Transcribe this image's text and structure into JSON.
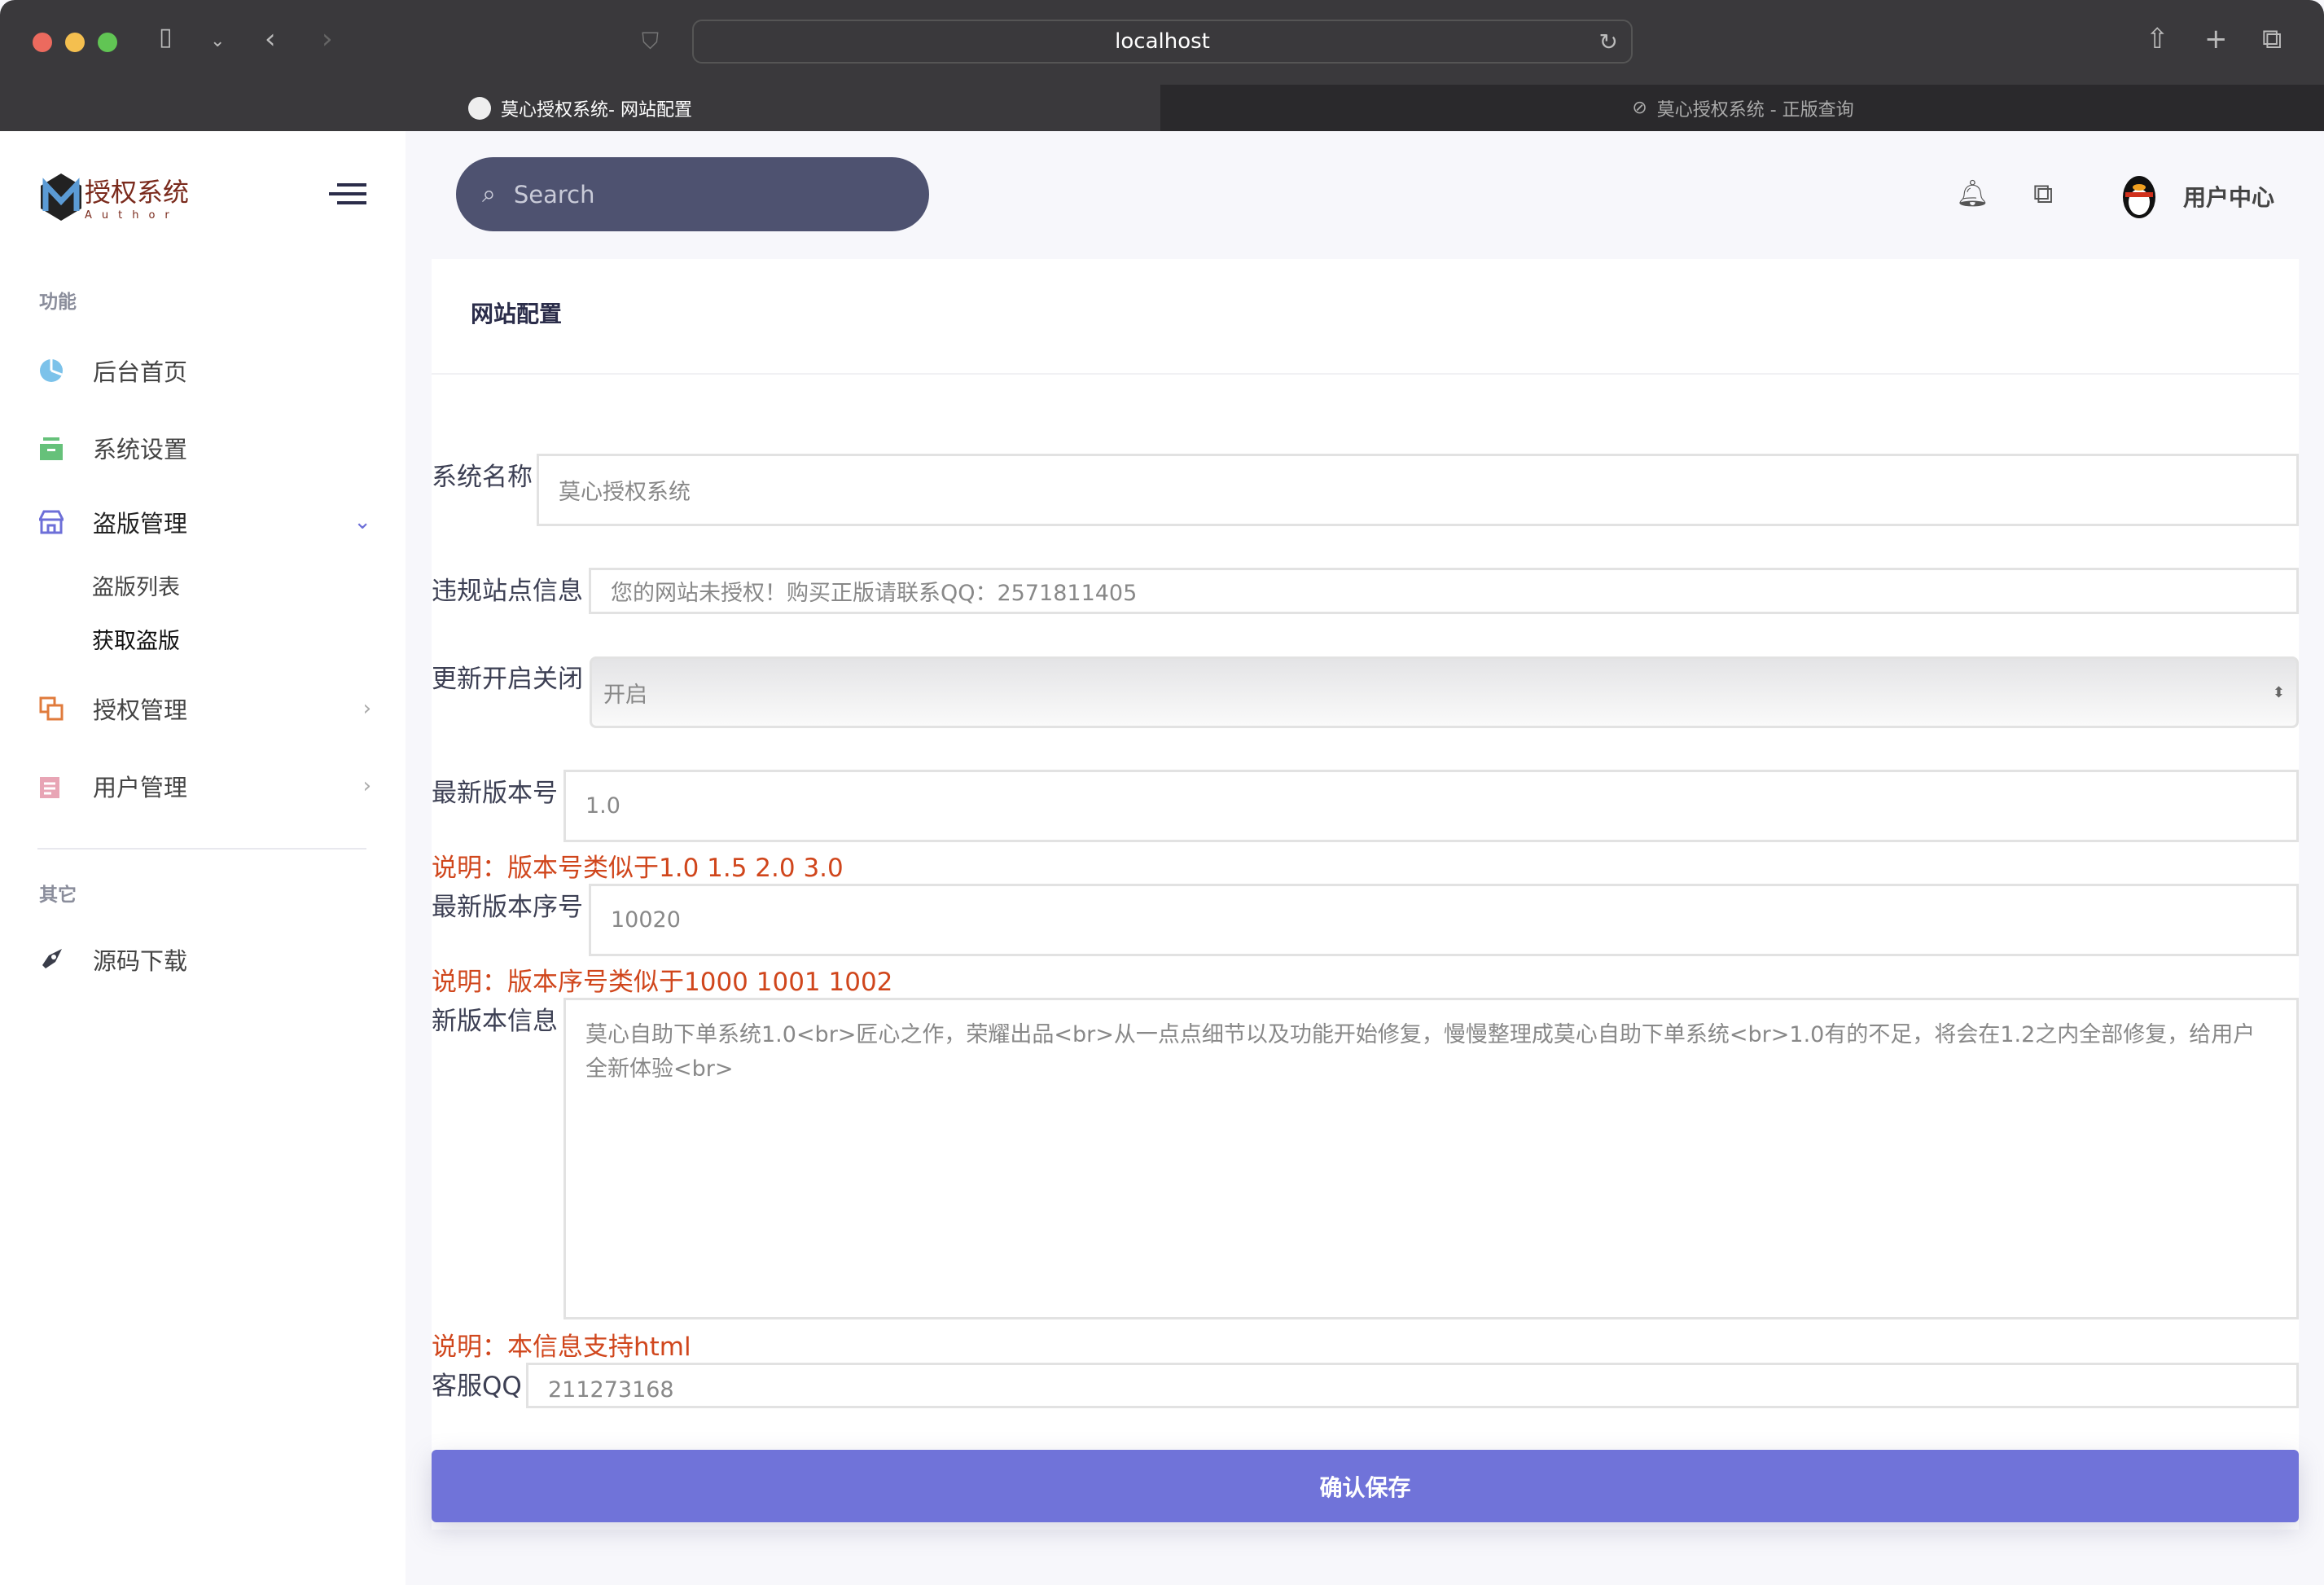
{
  "browser": {
    "url": "localhost",
    "tabs": [
      {
        "label": "莫心授权系统- 网站配置",
        "active": true
      },
      {
        "label": "莫心授权系统 - 正版查询",
        "active": false
      }
    ]
  },
  "sidebar": {
    "logo_text": "授权系统",
    "logo_sub": "Author",
    "section1": "功能",
    "section2": "其它",
    "items": [
      {
        "label": "后台首页",
        "icon": "pie-chart-icon"
      },
      {
        "label": "系统设置",
        "icon": "archive-icon"
      },
      {
        "label": "盗版管理",
        "icon": "store-icon",
        "expanded": true
      },
      {
        "label": "授权管理",
        "icon": "copy-icon"
      },
      {
        "label": "用户管理",
        "icon": "document-icon"
      }
    ],
    "subitems": [
      "盗版列表",
      "获取盗版"
    ],
    "other_items": [
      {
        "label": "源码下载",
        "icon": "rocket-icon"
      }
    ]
  },
  "header": {
    "search_placeholder": "Search",
    "user_label": "用户中心"
  },
  "card": {
    "title": "网站配置"
  },
  "form": {
    "site_name": {
      "label": "系统名称",
      "value": "莫心授权系统"
    },
    "violation": {
      "label": "违规站点信息",
      "value": "您的网站未授权！购买正版请联系QQ：2571811405"
    },
    "update": {
      "label": "更新开启关闭",
      "value": "开启"
    },
    "version": {
      "label": "最新版本号",
      "value": "1.0",
      "note": "说明：版本号类似于1.0 1.5 2.0 3.0"
    },
    "build": {
      "label": "最新版本序号",
      "value": "10020",
      "note": "说明：版本序号类似于1000 1001 1002"
    },
    "info": {
      "label": "新版本信息",
      "value": "莫心自助下单系统1.0<br>匠心之作，荣耀出品<br>从一点点细节以及功能开始修复，慢慢整理成莫心自助下单系统<br>1.0有的不足，将会在1.2之内全部修复，给用户全新体验<br>",
      "note": "说明：本信息支持html"
    },
    "qq": {
      "label": "客服QQ",
      "value": "211273168"
    },
    "save_label": "确认保存"
  },
  "colors": {
    "accent": "#7073d9",
    "note": "#d0461c",
    "search_bg": "#4e5270"
  }
}
